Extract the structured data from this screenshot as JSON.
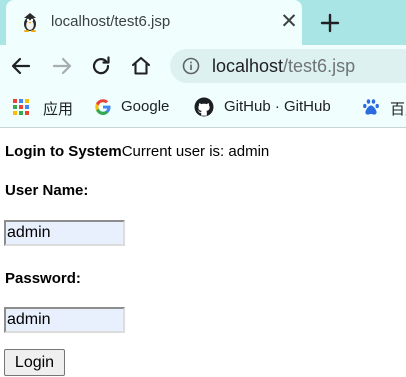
{
  "browser": {
    "tab": {
      "title": "localhost/test6.jsp",
      "favicon": "tux-penguin-icon"
    },
    "address": {
      "host": "localhost",
      "path": "/test6.jsp"
    },
    "bookmarks": [
      {
        "label": "应用",
        "icon": "apps-grid-icon"
      },
      {
        "label": "Google",
        "icon": "google-icon"
      },
      {
        "label": "GitHub · GitHub",
        "icon": "github-icon"
      },
      {
        "label": "百度",
        "icon": "baidu-paw-icon"
      }
    ]
  },
  "page": {
    "heading": "Login to System",
    "status": "Current user is: admin",
    "username_label": "User Name:",
    "username_value": "admin",
    "password_label": "Password:",
    "password_value": "admin",
    "login_button": "Login"
  },
  "colors": {
    "tabstrip": "#a9e5e4",
    "toolbar": "#f0fffe",
    "omnibox": "#def1f1",
    "autofill": "#e8f0fe"
  }
}
